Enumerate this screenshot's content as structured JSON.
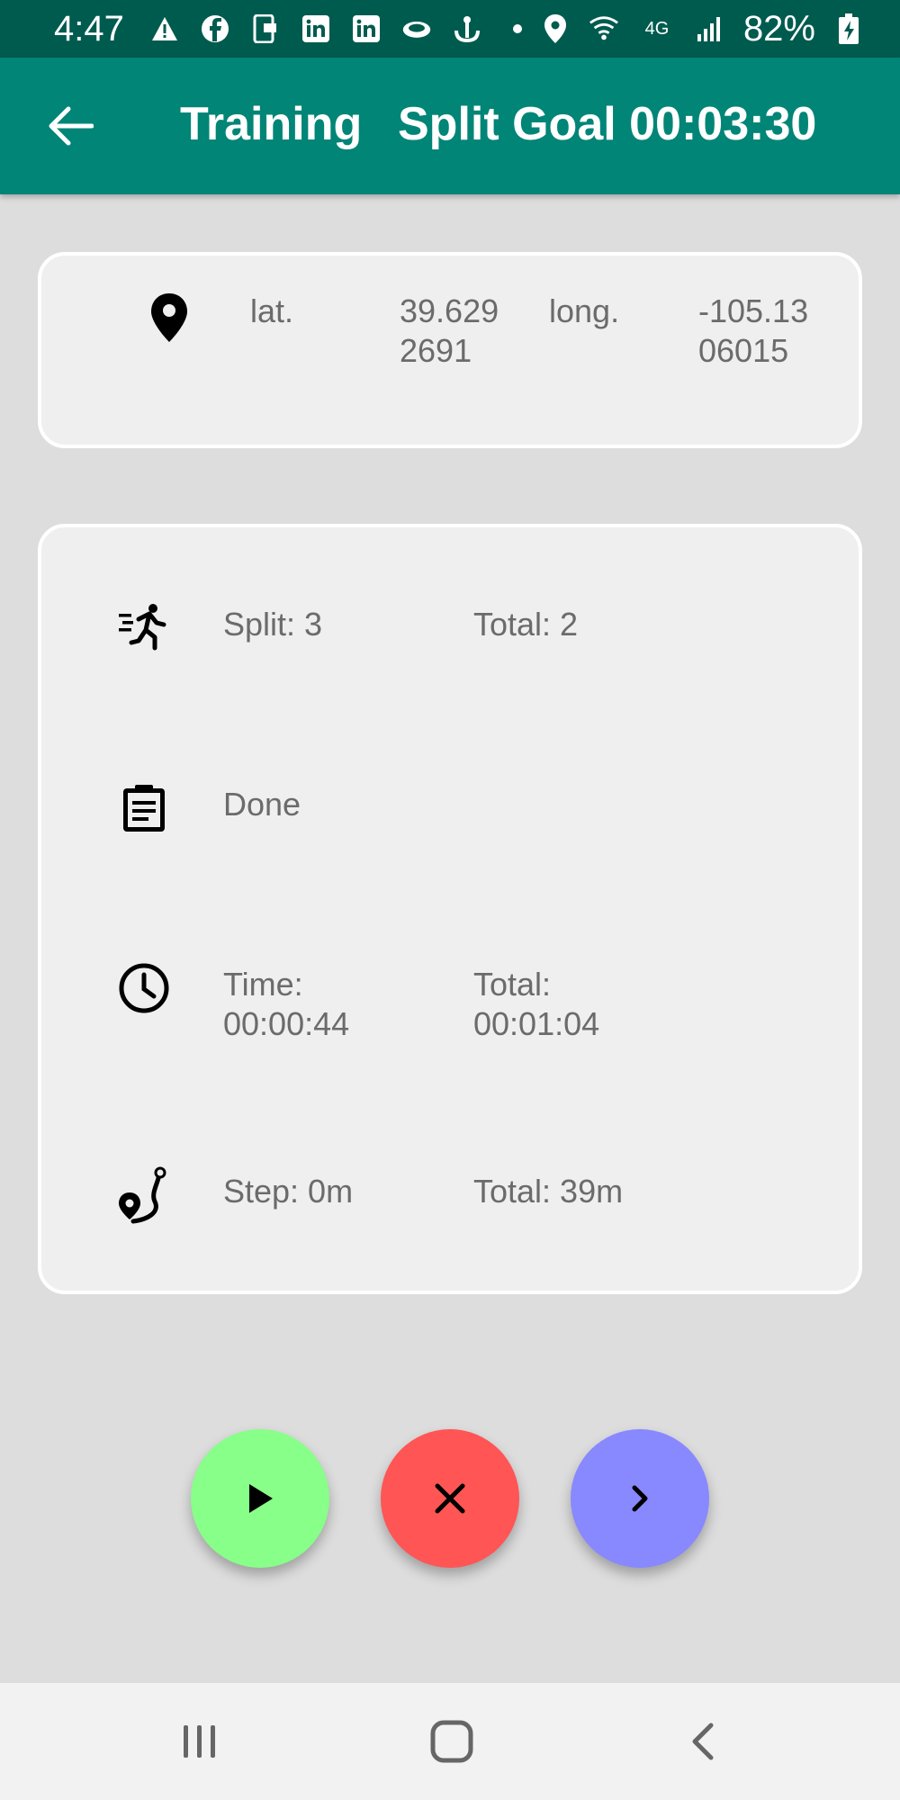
{
  "status_bar": {
    "time": "4:47",
    "battery": "82%",
    "network": "4G",
    "icons": [
      "alert-icon",
      "facebook-icon",
      "phone-id-icon",
      "linkedin-icon",
      "linkedin-icon",
      "cloud-icon",
      "anchor-icon",
      "dot-icon",
      "location-icon",
      "wifi-icon",
      "signal-icon",
      "battery-charging-icon"
    ]
  },
  "app_bar": {
    "title": "Training",
    "subtitle": "Split Goal 00:03:30",
    "background": "#008577"
  },
  "location": {
    "lat_label": "lat.",
    "lat_value": "39.6292691",
    "long_label": "long.",
    "long_value": "-105.1306015"
  },
  "stats": {
    "split_label": "Split: 3",
    "split_total": "Total: 2",
    "status": "Done",
    "time_label": "Time:",
    "time_value": "00:00:44",
    "time_total_label": "Total:",
    "time_total_value": "00:01:04",
    "step_label": "Step: 0m",
    "step_total": "Total: 39m"
  },
  "actions": {
    "play_color": "#88ff88",
    "stop_color": "#ff5555",
    "next_color": "#8888ff"
  }
}
